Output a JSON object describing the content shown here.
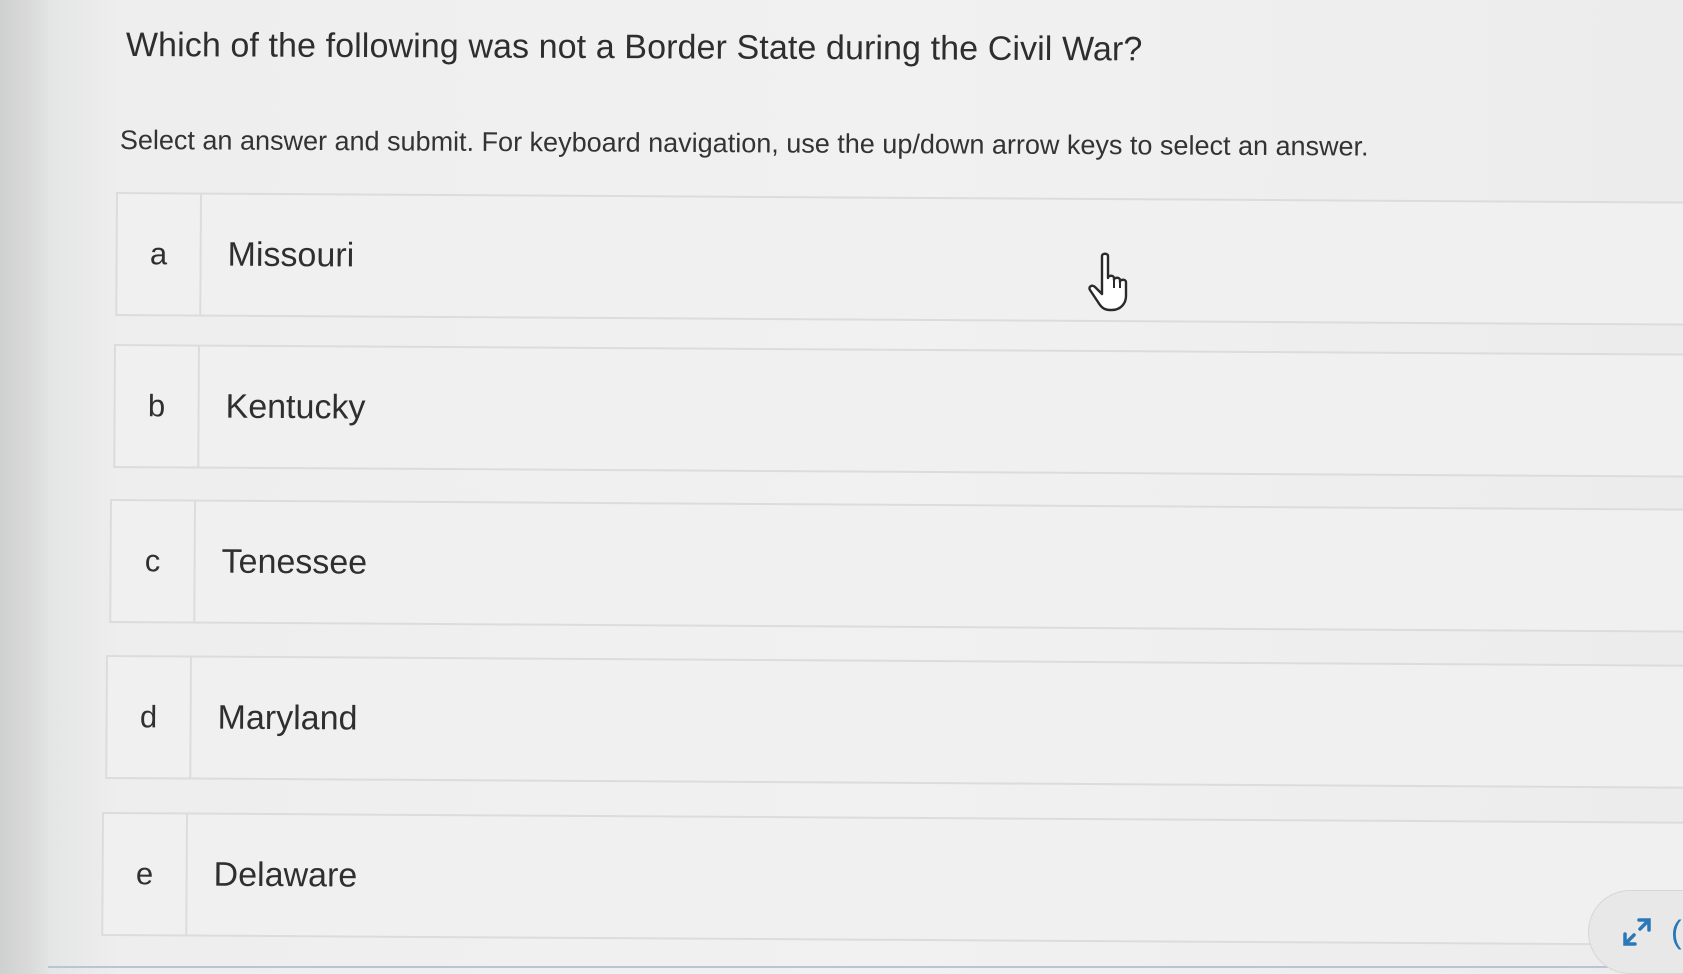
{
  "question": {
    "title": "Which of the following was not a Border State during the Civil War?",
    "instructions": "Select an answer and submit. For keyboard navigation, use the up/down arrow keys to select an answer."
  },
  "options": [
    {
      "letter": "a",
      "label": "Missouri"
    },
    {
      "letter": "b",
      "label": "Kentucky"
    },
    {
      "letter": "c",
      "label": "Tenessee"
    },
    {
      "letter": "d",
      "label": "Maryland"
    },
    {
      "letter": "e",
      "label": "Delaware"
    }
  ],
  "icons": {
    "cursor": "hand-pointer-icon",
    "expand": "expand-arrows-icon"
  },
  "colors": {
    "accent": "#2a78b8",
    "option_border": "#dcdcdc",
    "option_bg": "#f0f0f0",
    "text": "#2f2f2f"
  },
  "corner_glyph": "("
}
